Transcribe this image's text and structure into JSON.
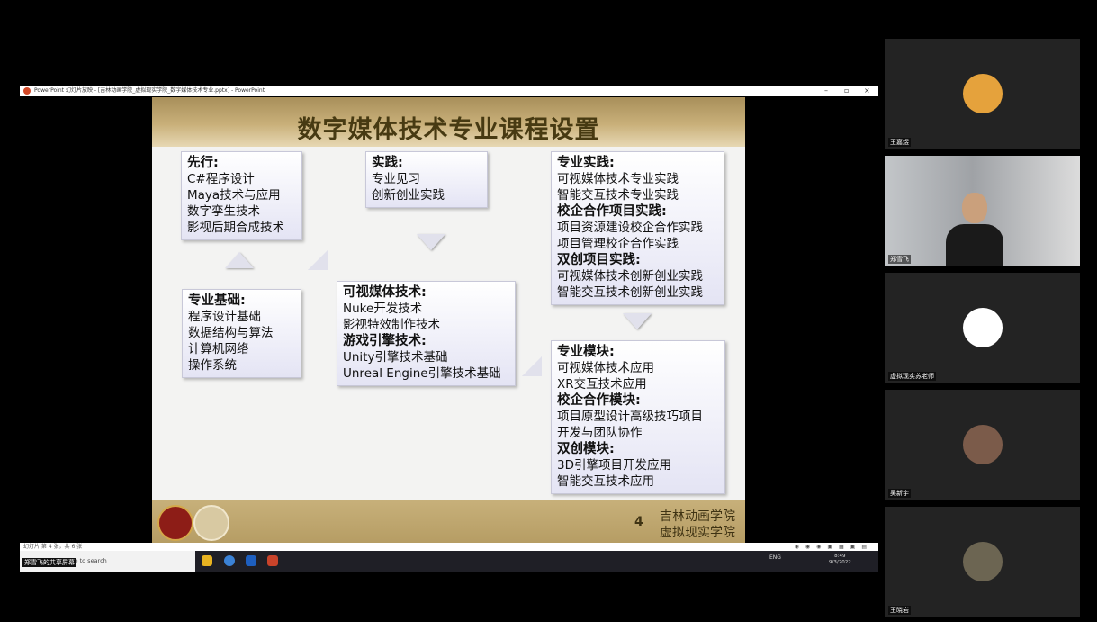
{
  "window": {
    "title": "PowerPoint 幻灯片放映 - [吉林动画学院_虚拟现实学院_数字媒体技术专业.pptx] - PowerPoint",
    "controls": [
      "–",
      "▫",
      "×"
    ]
  },
  "slide": {
    "title": "数字媒体技术专业课程设置",
    "page_number": "4",
    "school_line1": "吉林动画学院",
    "school_line2": "虚拟现实学院",
    "boxes": {
      "prereq": {
        "heading": "先行:",
        "items": [
          "C#程序设计",
          "Maya技术与应用",
          "数字孪生技术",
          "影视后期合成技术"
        ]
      },
      "practice": {
        "heading": "实践:",
        "items": [
          "专业见习",
          "创新创业实践"
        ]
      },
      "prof_practice": {
        "h1": "专业实践:",
        "items1": [
          "可视媒体技术专业实践",
          "智能交互技术专业实践"
        ],
        "h2": "校企合作项目实践:",
        "items2": [
          "项目资源建设校企合作实践",
          "项目管理校企合作实践"
        ],
        "h3": "双创项目实践:",
        "items3": [
          "可视媒体技术创新创业实践",
          "智能交互技术创新创业实践"
        ]
      },
      "foundation": {
        "heading": "专业基础:",
        "items": [
          "程序设计基础",
          "数据结构与算法",
          "计算机网络",
          "操作系统"
        ]
      },
      "core": {
        "h1": "可视媒体技术:",
        "items1": [
          "Nuke开发技术",
          "影视特效制作技术"
        ],
        "h2": "游戏引擎技术:",
        "items2": [
          "Unity引擎技术基础",
          "Unreal Engine引擎技术基础"
        ]
      },
      "modules": {
        "h1": "专业模块:",
        "items1": [
          "可视媒体技术应用",
          "XR交互技术应用"
        ],
        "h2": "校企合作模块:",
        "items2": [
          "项目原型设计高级技巧项目",
          "开发与团队协作"
        ],
        "h3": "双创模块:",
        "items3": [
          "3D引擎项目开发应用",
          "智能交互技术应用"
        ]
      }
    }
  },
  "statusbar": {
    "text": "幻灯片 第 4 张，共 6 张"
  },
  "taskbar": {
    "search_placeholder": "ere to search",
    "sharing_label": "郑雪飞的共享屏幕",
    "tray_lang": "ENG",
    "time": "8:49",
    "date": "9/3/2022"
  },
  "participants": [
    {
      "name": "王嘉煜"
    },
    {
      "name": "郑雪飞"
    },
    {
      "name": "虚拟现实苏老师"
    },
    {
      "name": "吴新宇"
    },
    {
      "name": "王晓岩"
    }
  ],
  "colors": {
    "slide_gold": "#c9b07a",
    "title_text": "#473a12",
    "tile_bg": "#232323"
  }
}
